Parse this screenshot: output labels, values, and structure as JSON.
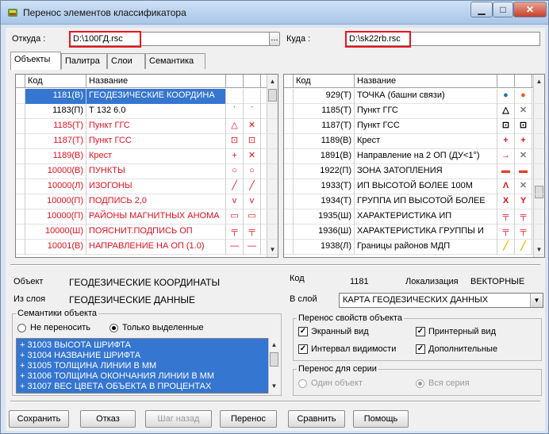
{
  "window": {
    "title": "Перенос элементов классификатора"
  },
  "source": {
    "label": "Откуда :",
    "path": "D:\\100ГД.rsc",
    "browse": "..."
  },
  "target": {
    "label": "Куда :",
    "path": "D:\\sk22rb.rsc"
  },
  "tabs": [
    "Объекты",
    "Палитра",
    "Слои",
    "Семантика"
  ],
  "left_table": {
    "headers": {
      "code": "Код",
      "name": "Название"
    },
    "rows": [
      {
        "code": "1181(В)",
        "name": "ГЕОДЕЗИЧЕСКИЕ КООРДИНА",
        "s1": "",
        "s2": "",
        "color": "#ffffff",
        "selected": true
      },
      {
        "code": "1183(П)",
        "name": "Т 132 6.0",
        "s1": "ˋ",
        "s2": "ˊ",
        "color": "#000000",
        "selected": false
      },
      {
        "code": "1185(Т)",
        "name": "Пункт ГГС",
        "s1": "△",
        "s2": "✕",
        "color": "#e0101e",
        "selected": false
      },
      {
        "code": "1187(Т)",
        "name": "Пункт ГСС",
        "s1": "⊡",
        "s2": "⊡",
        "color": "#e0101e",
        "selected": false
      },
      {
        "code": "1189(В)",
        "name": "Крест",
        "s1": "+",
        "s2": "✕",
        "color": "#e0101e",
        "selected": false
      },
      {
        "code": "10000(В)",
        "name": "ПУНКТЫ",
        "s1": "○",
        "s2": "○",
        "color": "#e0101e",
        "selected": false
      },
      {
        "code": "10000(Л)",
        "name": "ИЗОГОНЫ",
        "s1": "╱",
        "s2": "╱",
        "color": "#e0101e",
        "selected": false
      },
      {
        "code": "10000(П)",
        "name": "ПОДПИСЬ 2,0",
        "s1": "v",
        "s2": "v",
        "color": "#e0101e",
        "selected": false
      },
      {
        "code": "10000(П)",
        "name": "РАЙОНЫ МАГНИТНЫХ АНОМА",
        "s1": "▭",
        "s2": "▭",
        "color": "#e0101e",
        "selected": false
      },
      {
        "code": "10000(Ш)",
        "name": "ПОЯСНИТ.ПОДПИСЬ ОП",
        "s1": "╤",
        "s2": "╤",
        "color": "#e0101e",
        "selected": false
      },
      {
        "code": "10001(В)",
        "name": "НАПРАВЛЕНИЕ НА ОП (1.0)",
        "s1": "—",
        "s2": "—",
        "color": "#e0101e",
        "selected": false
      }
    ]
  },
  "right_table": {
    "headers": {
      "code": "Код",
      "name": "Название"
    },
    "rows": [
      {
        "code": "929(Т)",
        "name": "ТОЧКА (башни связи)",
        "s1": "●",
        "s2": "●",
        "c1": "#1a73b8",
        "c2": "#f05a1e"
      },
      {
        "code": "1185(Т)",
        "name": "Пункт ГГС",
        "s1": "△",
        "s2": "✕",
        "c1": "#000000",
        "c2": "#777777"
      },
      {
        "code": "1187(Т)",
        "name": "Пункт ГСС",
        "s1": "⊡",
        "s2": "⊡",
        "c1": "#000000",
        "c2": "#000000"
      },
      {
        "code": "1189(В)",
        "name": "Крест",
        "s1": "+",
        "s2": "+",
        "c1": "#e0101e",
        "c2": "#e0101e"
      },
      {
        "code": "1891(В)",
        "name": "Направление на 2 ОП (ДУ<1°)",
        "s1": "→",
        "s2": "✕",
        "c1": "#e0101e",
        "c2": "#777777"
      },
      {
        "code": "1922(П)",
        "name": "ЗОНА ЗАТОПЛЕНИЯ",
        "s1": "▬",
        "s2": "▬",
        "c1": "#e0402a",
        "c2": "#e0402a"
      },
      {
        "code": "1933(Т)",
        "name": "ИП ВЫСОТОЙ БОЛЕЕ 100М",
        "s1": "Λ",
        "s2": "✕",
        "c1": "#e0101e",
        "c2": "#777777"
      },
      {
        "code": "1934(Т)",
        "name": "ГРУППА ИП ВЫСОТОЙ БОЛЕЕ",
        "s1": "X",
        "s2": "Y",
        "c1": "#e0101e",
        "c2": "#e0101e"
      },
      {
        "code": "1935(Ш)",
        "name": "ХАРАКТЕРИСТИКА ИП",
        "s1": "╤",
        "s2": "╤",
        "c1": "#e0101e",
        "c2": "#e0101e"
      },
      {
        "code": "1936(Ш)",
        "name": "ХАРАКТЕРИСТИКА ГРУППЫ И",
        "s1": "╤",
        "s2": "╤",
        "c1": "#e0101e",
        "c2": "#e0101e"
      },
      {
        "code": "1938(Л)",
        "name": "Границы районов МДП",
        "s1": "╱",
        "s2": "╱",
        "c1": "#e8c000",
        "c2": "#e8c000"
      }
    ]
  },
  "info": {
    "object_label": "Объект",
    "object_value": "ГЕОДЕЗИЧЕСКИЕ КООРДИНАТЫ",
    "layer_label": "Из слоя",
    "layer_value": "ГЕОДЕЗИЧЕСКИЕ ДАННЫЕ",
    "code_label": "Код",
    "code_value": "1181",
    "loc_label": "Локализация",
    "loc_value": "ВЕКТОРНЫЕ",
    "to_layer_label": "В слой",
    "to_layer_value": "КАРТА ГЕОДЕЗИЧЕСКИХ ДАННЫХ"
  },
  "semantics": {
    "group_title": "Семантики объекта",
    "opt_none": "Не переносить",
    "opt_selected": "Только выделенные",
    "items": [
      "+ 31003 ВЫСОТА ШРИФТА",
      "+ 31004 НАЗВАНИЕ ШРИФТА",
      "+ 31005 ТОЛЩИНА ЛИНИИ В ММ",
      "+ 31006 ТОЛЩИНА ОКОНЧАНИЯ ЛИНИИ В ММ",
      "+ 31007 ВЕС ЦВЕТА ОБЪЕКТА В ПРОЦЕНТАХ"
    ]
  },
  "props": {
    "group_title": "Перенос свойств объекта",
    "screen": "Экранный вид",
    "printer": "Принтерный вид",
    "visibility": "Интервал видимости",
    "additional": "Дополнительные"
  },
  "series": {
    "group_title": "Перенос для серии",
    "one": "Один объект",
    "all": "Вся серия"
  },
  "buttons": {
    "save": "Сохранить",
    "cancel": "Отказ",
    "back": "Шаг назад",
    "transfer": "Перенос",
    "compare": "Сравнить",
    "help": "Помощь"
  },
  "colors": {
    "accent": "#3576d0",
    "highlight": "#e8141c"
  }
}
